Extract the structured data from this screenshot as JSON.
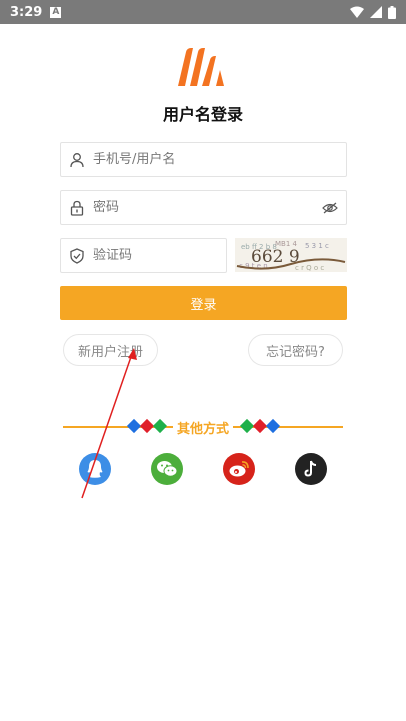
{
  "status_bar": {
    "time": "3:29",
    "notification": "A"
  },
  "page": {
    "title": "用户名登录"
  },
  "form": {
    "username_placeholder": "手机号/用户名",
    "password_placeholder": "密码",
    "captcha_placeholder": "验证码",
    "captcha_text": "662 9"
  },
  "actions": {
    "login_label": "登录",
    "register_label": "新用户注册",
    "forgot_label": "忘记密码?"
  },
  "other_methods": {
    "label": "其他方式",
    "icons": [
      "qq-icon",
      "wechat-icon",
      "weibo-icon",
      "douyin-icon"
    ]
  },
  "colors": {
    "accent": "#f5a623",
    "status_bar": "#7a7a7a",
    "qq": "#3d8ee6",
    "wechat": "#4cae3b",
    "weibo": "#d6231a",
    "douyin": "#222222"
  }
}
